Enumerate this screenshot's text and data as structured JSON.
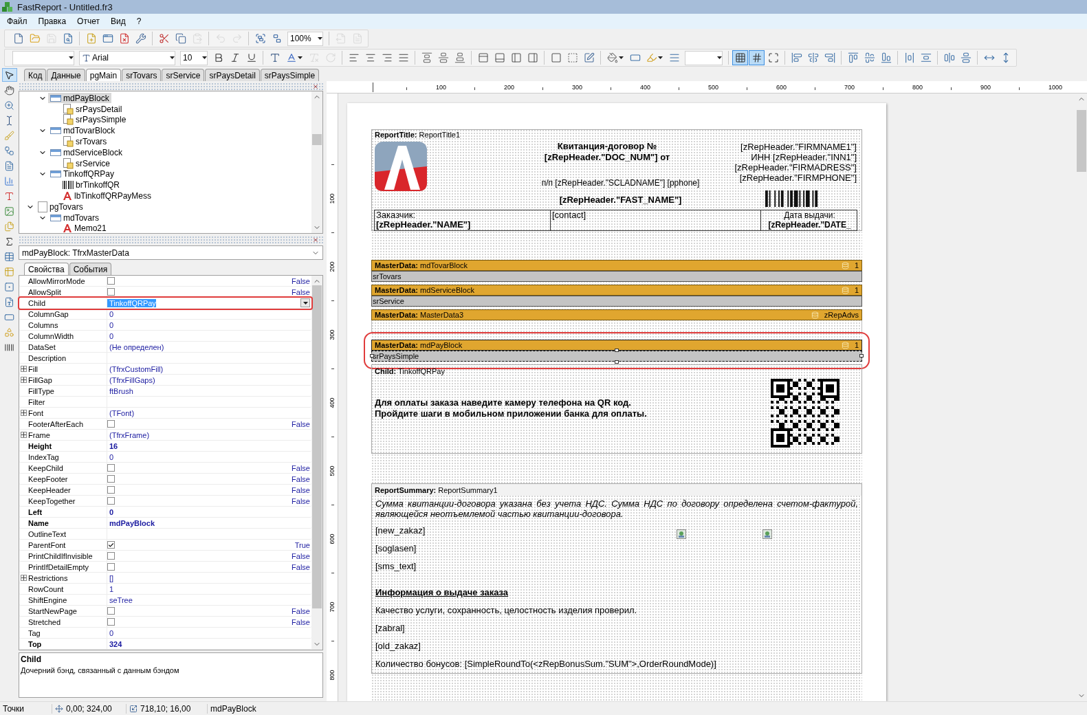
{
  "window": {
    "title": "FastReport - Untitled.fr3"
  },
  "menu": [
    "Файл",
    "Правка",
    "Отчет",
    "Вид",
    "?"
  ],
  "toolbar1": [
    {
      "kind": "new",
      "disabled": false
    },
    {
      "kind": "open",
      "disabled": false
    },
    {
      "kind": "save",
      "disabled": true
    },
    {
      "kind": "preview",
      "disabled": false
    },
    {
      "kind": "separator"
    },
    {
      "kind": "new_page",
      "disabled": false
    },
    {
      "kind": "new_dialog",
      "disabled": false
    },
    {
      "kind": "delete_page",
      "disabled": false
    },
    {
      "kind": "page_settings",
      "disabled": false
    },
    {
      "kind": "separator"
    },
    {
      "kind": "cut",
      "disabled": false
    },
    {
      "kind": "copy",
      "disabled": false
    },
    {
      "kind": "paste",
      "disabled": true
    },
    {
      "kind": "separator"
    },
    {
      "kind": "undo",
      "disabled": true
    },
    {
      "kind": "redo",
      "disabled": true
    },
    {
      "kind": "separator"
    },
    {
      "kind": "group",
      "disabled": false
    },
    {
      "kind": "ungroup",
      "disabled": false
    },
    {
      "kind": "zoom_combo",
      "value": "100%",
      "disabled": false
    },
    {
      "kind": "separator"
    },
    {
      "kind": "export",
      "disabled": true
    },
    {
      "kind": "export_word",
      "disabled": true
    }
  ],
  "toolbar2": [
    {
      "kind": "style_combo",
      "disabled": false
    },
    {
      "kind": "font_combo",
      "value": "Arial",
      "disabled": false
    },
    {
      "kind": "size_combo",
      "value": "10",
      "disabled": false
    },
    {
      "kind": "bold",
      "pressed": false,
      "disabled": false
    },
    {
      "kind": "italic",
      "pressed": false,
      "disabled": false
    },
    {
      "kind": "underline",
      "pressed": false,
      "disabled": false
    },
    {
      "kind": "separator"
    },
    {
      "kind": "font_style",
      "pressed": false,
      "disabled": false
    },
    {
      "kind": "font_color",
      "pressed": false,
      "disabled": false
    },
    {
      "kind": "highlight",
      "pressed": false,
      "disabled": true
    },
    {
      "kind": "rotate",
      "pressed": false,
      "disabled": true
    },
    {
      "kind": "separator"
    },
    {
      "kind": "align_left",
      "pressed": false,
      "disabled": false
    },
    {
      "kind": "align_center",
      "pressed": false,
      "disabled": false
    },
    {
      "kind": "align_right",
      "pressed": false,
      "disabled": false
    },
    {
      "kind": "justify",
      "pressed": false,
      "disabled": false
    },
    {
      "kind": "separator"
    },
    {
      "kind": "valign_top",
      "pressed": false,
      "disabled": false
    },
    {
      "kind": "valign_middle",
      "pressed": false,
      "disabled": false
    },
    {
      "kind": "valign_bottom",
      "pressed": false,
      "disabled": false
    },
    {
      "kind": "separator"
    },
    {
      "kind": "frame_top",
      "pressed": false,
      "disabled": false
    },
    {
      "kind": "frame_bottom",
      "pressed": false,
      "disabled": false
    },
    {
      "kind": "frame_left",
      "pressed": false,
      "disabled": false
    },
    {
      "kind": "frame_right",
      "pressed": false,
      "disabled": false
    },
    {
      "kind": "separator"
    },
    {
      "kind": "frame_all",
      "pressed": false,
      "disabled": false
    },
    {
      "kind": "frame_none",
      "pressed": false,
      "disabled": false
    },
    {
      "kind": "frame_edit",
      "pressed": false,
      "disabled": false
    },
    {
      "kind": "separator"
    },
    {
      "kind": "fill_color",
      "pressed": false,
      "disabled": false
    },
    {
      "kind": "shadow",
      "pressed": false,
      "disabled": false
    },
    {
      "kind": "line_color",
      "pressed": false,
      "disabled": false
    },
    {
      "kind": "line_style",
      "pressed": false,
      "disabled": false
    },
    {
      "kind": "line_combo",
      "disabled": false
    },
    {
      "kind": "separator"
    },
    {
      "kind": "grid",
      "pressed": true,
      "disabled": false
    },
    {
      "kind": "snap_grid",
      "pressed": true,
      "disabled": false
    },
    {
      "kind": "fit_grid",
      "pressed": false,
      "disabled": false
    },
    {
      "kind": "separator"
    },
    {
      "kind": "align_lefts",
      "pressed": false,
      "disabled": false
    },
    {
      "kind": "align_centers",
      "pressed": false,
      "disabled": false
    },
    {
      "kind": "align_rights",
      "pressed": false,
      "disabled": false
    },
    {
      "kind": "separator"
    },
    {
      "kind": "align_tops",
      "pressed": false,
      "disabled": false
    },
    {
      "kind": "align_middles",
      "pressed": false,
      "disabled": false
    },
    {
      "kind": "align_bottoms",
      "pressed": false,
      "disabled": false
    },
    {
      "kind": "separator"
    },
    {
      "kind": "space_h",
      "pressed": false,
      "disabled": false
    },
    {
      "kind": "space_v",
      "pressed": false,
      "disabled": false
    },
    {
      "kind": "separator"
    },
    {
      "kind": "center_h",
      "pressed": false,
      "disabled": false
    },
    {
      "kind": "center_v",
      "pressed": false,
      "disabled": false
    },
    {
      "kind": "separator"
    },
    {
      "kind": "same_width",
      "pressed": false,
      "disabled": false
    },
    {
      "kind": "same_height",
      "pressed": false,
      "disabled": false
    }
  ],
  "tool_palette": [
    {
      "kind": "pointer",
      "selected": true
    },
    {
      "kind": "hand",
      "selected": false
    },
    {
      "kind": "zoom",
      "selected": false
    },
    {
      "kind": "text_edit",
      "selected": false
    },
    {
      "kind": "format_painter",
      "selected": false
    },
    {
      "kind": "diagram",
      "selected": false
    },
    {
      "kind": "memo",
      "selected": false
    },
    {
      "kind": "chart",
      "selected": false
    },
    {
      "kind": "text",
      "selected": false
    },
    {
      "kind": "picture",
      "selected": false
    },
    {
      "kind": "subreport",
      "selected": false
    },
    {
      "kind": "sum",
      "selected": false
    },
    {
      "kind": "cross",
      "selected": false
    },
    {
      "kind": "table",
      "selected": false
    },
    {
      "kind": "checkbox",
      "selected": false
    },
    {
      "kind": "rich",
      "selected": false
    },
    {
      "kind": "band",
      "selected": false
    },
    {
      "kind": "shapes",
      "selected": false
    },
    {
      "kind": "barcode",
      "selected": false
    }
  ],
  "page_tabs": [
    {
      "label": "Код",
      "selected": false
    },
    {
      "label": "Данные",
      "selected": false
    },
    {
      "label": "pgMain",
      "selected": true
    },
    {
      "label": "srTovars",
      "selected": false
    },
    {
      "label": "srService",
      "selected": false
    },
    {
      "label": "srPaysDetail",
      "selected": false
    },
    {
      "label": "srPaysSimple",
      "selected": false
    }
  ],
  "tree": {
    "partial_branch": [
      {
        "label": "mdPayBlock",
        "kind": "band",
        "expanded": true,
        "selected": true,
        "children": [
          {
            "label": "srPaysDetail",
            "kind": "subreport",
            "selected": false
          },
          {
            "label": "srPaysSimple",
            "kind": "subreport",
            "selected": false
          }
        ]
      },
      {
        "label": "mdTovarBlock",
        "kind": "band",
        "expanded": true,
        "selected": false,
        "children": [
          {
            "label": "srTovars",
            "kind": "subreport",
            "selected": false
          }
        ]
      },
      {
        "label": "mdServiceBlock",
        "kind": "band",
        "expanded": true,
        "selected": false,
        "children": [
          {
            "label": "srService",
            "kind": "subreport",
            "selected": false
          }
        ]
      },
      {
        "label": "TinkoffQRPay",
        "kind": "band",
        "expanded": true,
        "selected": false,
        "children": [
          {
            "label": "brTinkoffQR",
            "kind": "barcode",
            "selected": false
          },
          {
            "label": "lbTinkoffQRPayMess",
            "kind": "text",
            "selected": false
          }
        ]
      }
    ],
    "items": [
      {
        "label": "pgTovars",
        "kind": "page",
        "expanded": true,
        "selected": false,
        "children": [
          {
            "label": "mdTovars",
            "kind": "band",
            "expanded": true,
            "selected": false,
            "children": [
              {
                "label": "Memo21",
                "kind": "text",
                "selected": false
              }
            ]
          }
        ]
      }
    ]
  },
  "object_selector": "mdPayBlock: TfrxMasterData",
  "inspector_tabs": [
    {
      "label": "Свойства",
      "selected": true
    },
    {
      "label": "События",
      "selected": false
    }
  ],
  "properties": [
    {
      "name": "AllowMirrorMode",
      "value": "False",
      "kind": "bool",
      "checked": false,
      "modified": false,
      "selected": false,
      "highlighted": false
    },
    {
      "name": "AllowSplit",
      "value": "False",
      "kind": "bool",
      "checked": false,
      "modified": false,
      "selected": false,
      "highlighted": false
    },
    {
      "name": "Child",
      "value": "TinkoffQRPay",
      "kind": "text",
      "modified": false,
      "selected": true,
      "highlighted": true
    },
    {
      "name": "ColumnGap",
      "value": "0",
      "kind": "text",
      "modified": false,
      "selected": false,
      "highlighted": false
    },
    {
      "name": "Columns",
      "value": "0",
      "kind": "text",
      "modified": false,
      "selected": false,
      "highlighted": false
    },
    {
      "name": "ColumnWidth",
      "value": "0",
      "kind": "text",
      "modified": false,
      "selected": false,
      "highlighted": false
    },
    {
      "name": "DataSet",
      "value": "(Не определен)",
      "kind": "text",
      "modified": false,
      "selected": false,
      "highlighted": false
    },
    {
      "name": "Description",
      "kind": "text",
      "modified": false,
      "selected": false,
      "highlighted": false
    },
    {
      "name": "Fill",
      "value": "(TfrxCustomFill)",
      "kind": "object",
      "modified": false,
      "selected": false,
      "highlighted": false
    },
    {
      "name": "FillGap",
      "value": "(TfrxFillGaps)",
      "kind": "object",
      "modified": false,
      "selected": false,
      "highlighted": false
    },
    {
      "name": "FillType",
      "value": "ftBrush",
      "kind": "text",
      "modified": false,
      "selected": false,
      "highlighted": false
    },
    {
      "name": "Filter",
      "kind": "text",
      "modified": false,
      "selected": false,
      "highlighted": false
    },
    {
      "name": "Font",
      "value": "(TFont)",
      "kind": "object",
      "modified": false,
      "selected": false,
      "highlighted": false
    },
    {
      "name": "FooterAfterEach",
      "value": "False",
      "kind": "bool",
      "checked": false,
      "modified": false,
      "selected": false,
      "highlighted": false
    },
    {
      "name": "Frame",
      "value": "(TfrxFrame)",
      "kind": "object",
      "modified": false,
      "selected": false,
      "highlighted": false
    },
    {
      "name": "Height",
      "value": "16",
      "kind": "text",
      "modified": true,
      "selected": false,
      "highlighted": false
    },
    {
      "name": "IndexTag",
      "value": "0",
      "kind": "text",
      "modified": false,
      "selected": false,
      "highlighted": false
    },
    {
      "name": "KeepChild",
      "value": "False",
      "kind": "bool",
      "checked": false,
      "modified": false,
      "selected": false,
      "highlighted": false
    },
    {
      "name": "KeepFooter",
      "value": "False",
      "kind": "bool",
      "checked": false,
      "modified": false,
      "selected": false,
      "highlighted": false
    },
    {
      "name": "KeepHeader",
      "value": "False",
      "kind": "bool",
      "checked": false,
      "modified": false,
      "selected": false,
      "highlighted": false
    },
    {
      "name": "KeepTogether",
      "value": "False",
      "kind": "bool",
      "checked": false,
      "modified": false,
      "selected": false,
      "highlighted": false
    },
    {
      "name": "Left",
      "value": "0",
      "kind": "text",
      "modified": true,
      "selected": false,
      "highlighted": false
    },
    {
      "name": "Name",
      "value": "mdPayBlock",
      "kind": "text",
      "modified": true,
      "selected": false,
      "highlighted": false
    },
    {
      "name": "OutlineText",
      "kind": "text",
      "modified": false,
      "selected": false,
      "highlighted": false
    },
    {
      "name": "ParentFont",
      "value": "True",
      "kind": "bool",
      "checked": true,
      "modified": false,
      "selected": false,
      "highlighted": false
    },
    {
      "name": "PrintChildIfInvisible",
      "value": "False",
      "kind": "bool",
      "checked": false,
      "modified": false,
      "selected": false,
      "highlighted": false
    },
    {
      "name": "PrintIfDetailEmpty",
      "value": "False",
      "kind": "bool",
      "checked": false,
      "modified": false,
      "selected": false,
      "highlighted": false
    },
    {
      "name": "Restrictions",
      "value": "[]",
      "kind": "object",
      "modified": false,
      "selected": false,
      "highlighted": false
    },
    {
      "name": "RowCount",
      "value": "1",
      "kind": "text",
      "modified": false,
      "selected": false,
      "highlighted": false
    },
    {
      "name": "ShiftEngine",
      "value": "seTree",
      "kind": "text",
      "modified": false,
      "selected": false,
      "highlighted": false
    },
    {
      "name": "StartNewPage",
      "value": "False",
      "kind": "bool",
      "checked": false,
      "modified": false,
      "selected": false,
      "highlighted": false
    },
    {
      "name": "Stretched",
      "value": "False",
      "kind": "bool",
      "checked": false,
      "modified": false,
      "selected": false,
      "highlighted": false
    },
    {
      "name": "Tag",
      "value": "0",
      "kind": "text",
      "modified": false,
      "selected": false,
      "highlighted": false
    },
    {
      "name": "Top",
      "value": "324",
      "kind": "text",
      "modified": true,
      "selected": false,
      "highlighted": false
    }
  ],
  "description": {
    "title": "Child",
    "text": "Дочерний бэнд, связанный с данным бэндом"
  },
  "rulers": {
    "horizontal": [
      "100",
      "200",
      "300",
      "400",
      "500",
      "600",
      "700",
      "800",
      "900",
      "1000"
    ],
    "vertical": [
      "100",
      "200",
      "300",
      "400",
      "500",
      "600",
      "700",
      "800"
    ]
  },
  "report": {
    "title_band": {
      "type": "ReportTitle:",
      "name": "ReportTitle1",
      "heading": "Квитанция-договор №\n[zRepHeader.\"DOC_NUM\"] от",
      "subheading": "п/п [zRepHeader.\"SCLADNAME\"] [pphone]",
      "fast_name": "[zRepHeader.\"FAST_NAME\"]",
      "firm": "[zRepHeader.\"FIRMNAME1\"]\nИНН [zRepHeader.\"INN1\"]\n[zRepHeader.\"FIRMADRESS\"]\n[zRepHeader.\"FIRMPHONE\"]",
      "customer_label": "Заказчик:",
      "customer_name": "[zRepHeader.\"NAME\"]",
      "contact": "[contact]",
      "date_label": "Дата выдачи:",
      "date_value": "[zRepHeader.\"DATE_"
    },
    "bands": [
      {
        "type": "MasterData:",
        "name": "mdTovarBlock",
        "source": "1",
        "subreport": "srTovars",
        "selected": false,
        "highlighted": false
      },
      {
        "type": "MasterData:",
        "name": "mdServiceBlock",
        "source": "1",
        "subreport": "srService",
        "selected": false,
        "highlighted": false
      },
      {
        "type": "MasterData:",
        "name": "MasterData3",
        "source": "zRepAdvs",
        "selected": false,
        "highlighted": false
      },
      {
        "type": "MasterData:",
        "name": "mdPayBlock",
        "source": "1",
        "subreport": "srPaysSimple",
        "selected": true,
        "highlighted": true
      }
    ],
    "child_band": {
      "type": "Child:",
      "name": "TinkoffQRPay",
      "message": "Для оплаты заказа наведите камеру телефона на QR код.\nПройдите шаги в мобильном приложении банка для оплаты."
    },
    "summary_band": {
      "type": "ReportSummary:",
      "name": "ReportSummary1",
      "items": [
        {
          "kind": "note",
          "text": "Сумма квитанции-договора указана без учета НДС. Сумма НДС по договору определена счетом-фактурой, являющейся неотъемлемой частью квитанции-договора."
        },
        {
          "kind": "field",
          "text": "[new_zakaz]"
        },
        {
          "kind": "field",
          "text": "[soglasen]"
        },
        {
          "kind": "field",
          "text": "[sms_text]"
        },
        {
          "kind": "heading",
          "text": "Информация о выдаче заказа"
        },
        {
          "kind": "plain",
          "text": "Качество услуги, сохранность, целостность изделия проверил."
        },
        {
          "kind": "field",
          "text": "[zabral]"
        },
        {
          "kind": "field",
          "text": "[old_zakaz]"
        },
        {
          "kind": "field",
          "text": "Количество бонусов: [SimpleRoundTo(<zRepBonusSum.\"SUM\">,OrderRoundMode)]"
        }
      ]
    }
  },
  "status_bar": {
    "units": "Точки",
    "position": "0,00; 324,00",
    "size": "718,10; 16,00",
    "object": "mdPayBlock"
  }
}
